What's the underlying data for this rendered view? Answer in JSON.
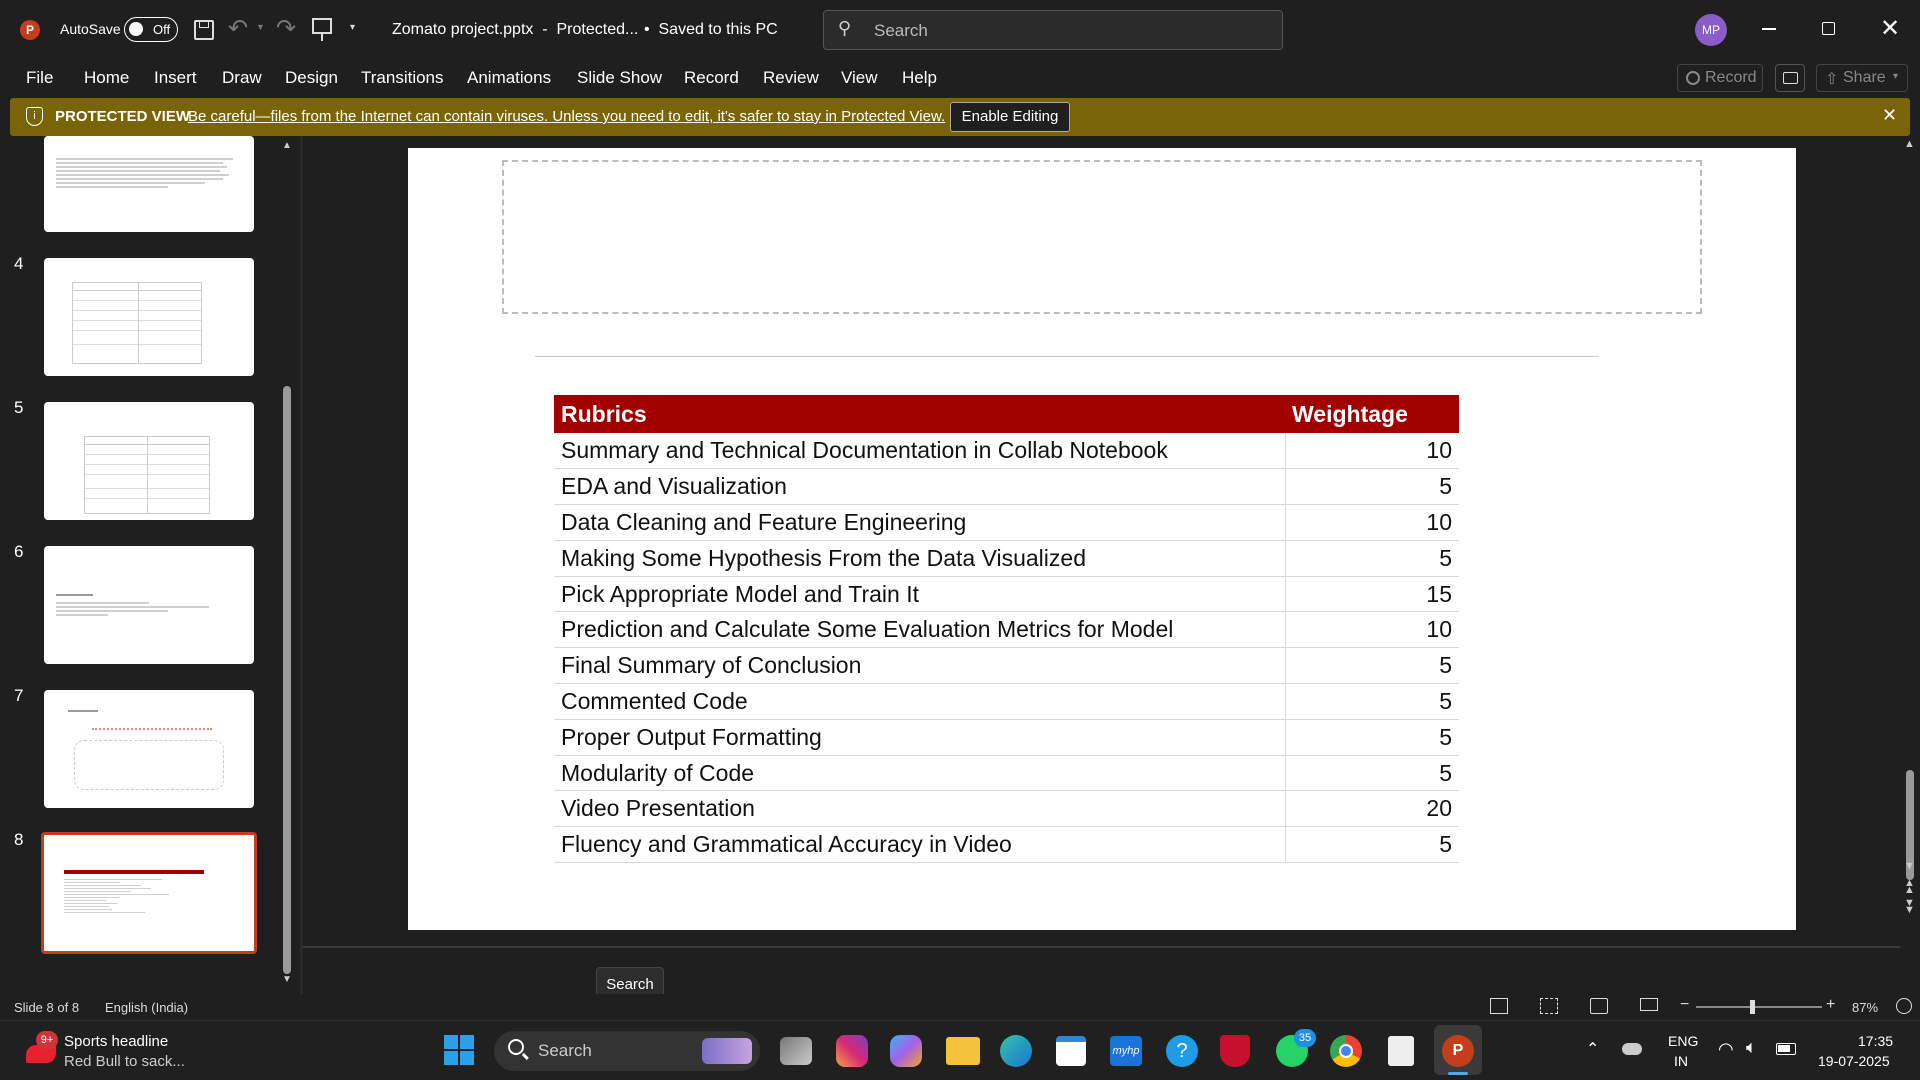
{
  "titlebar": {
    "autosave_label": "AutoSave",
    "autosave_state": "Off",
    "filename": "Zomato project.pptx  -  Protected...",
    "saved_status": "•  Saved to this PC",
    "search_placeholder": "Search",
    "avatar_initials": "MP"
  },
  "menu": {
    "items": [
      "File",
      "Home",
      "Insert",
      "Draw",
      "Design",
      "Transitions",
      "Animations",
      "Slide Show",
      "Record",
      "Review",
      "View",
      "Help"
    ],
    "record_button": "Record",
    "share_button": "Share"
  },
  "protected": {
    "title": "PROTECTED VIEW",
    "message": "Be careful—files from the Internet can contain viruses. Unless you need to edit, it's safer to stay in Protected View.",
    "button": "Enable Editing"
  },
  "thumbnails": {
    "numbers": [
      "4",
      "5",
      "6",
      "7",
      "8"
    ]
  },
  "slide": {
    "header_rubrics": "Rubrics",
    "header_weightage": "Weightage",
    "rows": [
      {
        "rubric": "Summary and Technical Documentation in Collab Notebook",
        "weight": "10"
      },
      {
        "rubric": "EDA and Visualization",
        "weight": "5"
      },
      {
        "rubric": "Data Cleaning and Feature Engineering",
        "weight": "10"
      },
      {
        "rubric": "Making Some Hypothesis From the Data Visualized",
        "weight": "5"
      },
      {
        "rubric": "Pick Appropriate Model and Train It",
        "weight": "15"
      },
      {
        "rubric": "Prediction and Calculate Some Evaluation Metrics for Model",
        "weight": "10"
      },
      {
        "rubric": "Final Summary of Conclusion",
        "weight": "5"
      },
      {
        "rubric": "Commented Code",
        "weight": "5"
      },
      {
        "rubric": "Proper Output Formatting",
        "weight": "5"
      },
      {
        "rubric": "Modularity of Code",
        "weight": "5"
      },
      {
        "rubric": "Video Presentation",
        "weight": "20"
      },
      {
        "rubric": "Fluency and Grammatical Accuracy in Video",
        "weight": "5"
      }
    ]
  },
  "tooltip": "Search",
  "status": {
    "slide_info": "Slide 8 of 8",
    "language": "English (India)",
    "zoom": "87%"
  },
  "taskbar": {
    "news_title": "Sports headline",
    "news_sub": "Red Bull to sack...",
    "news_badge": "9+",
    "search_label": "Search",
    "whatsapp_badge": "35",
    "lang_line1": "ENG",
    "lang_line2": "IN",
    "time": "17:35",
    "date": "19-07-2025"
  },
  "colors": {
    "table_header": "#a00000",
    "protected_bar": "#7a6408",
    "ppt_brand": "#c43e1c"
  }
}
